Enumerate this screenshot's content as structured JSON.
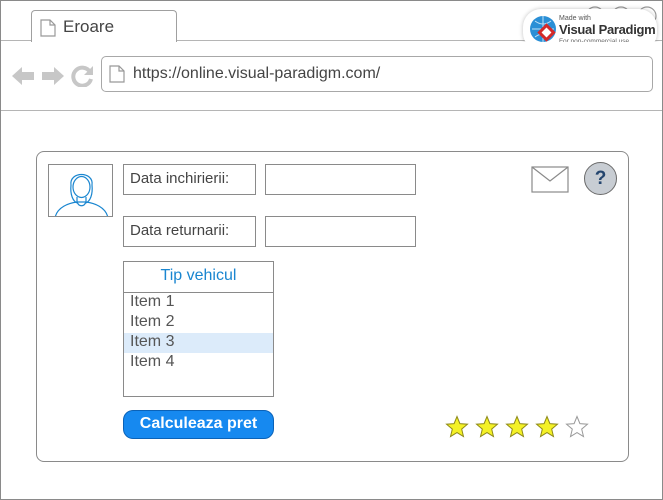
{
  "browser": {
    "tab_title": "Eroare",
    "url": "https://online.visual-paradigm.com/",
    "badge": {
      "made_with": "Made with",
      "brand": "Visual Paradigm",
      "note": "For non-commercial use"
    }
  },
  "form": {
    "rental_date_label": "Data inchirierii:",
    "rental_date_value": "",
    "return_date_label": "Data returnarii:",
    "return_date_value": "",
    "vehicle_list": {
      "title": "Tip vehicul",
      "items": [
        "Item 1",
        "Item 2",
        "Item 3",
        "Item 4"
      ],
      "selected": "Item 3"
    },
    "calculate_button": "Calculeaza pret",
    "help_label": "?",
    "rating": {
      "value": 4,
      "max": 5
    }
  },
  "colors": {
    "accent": "#1689f0",
    "list_title": "#1a86d0",
    "selection": "#dcebfa",
    "star_fill": "#f4f126"
  }
}
